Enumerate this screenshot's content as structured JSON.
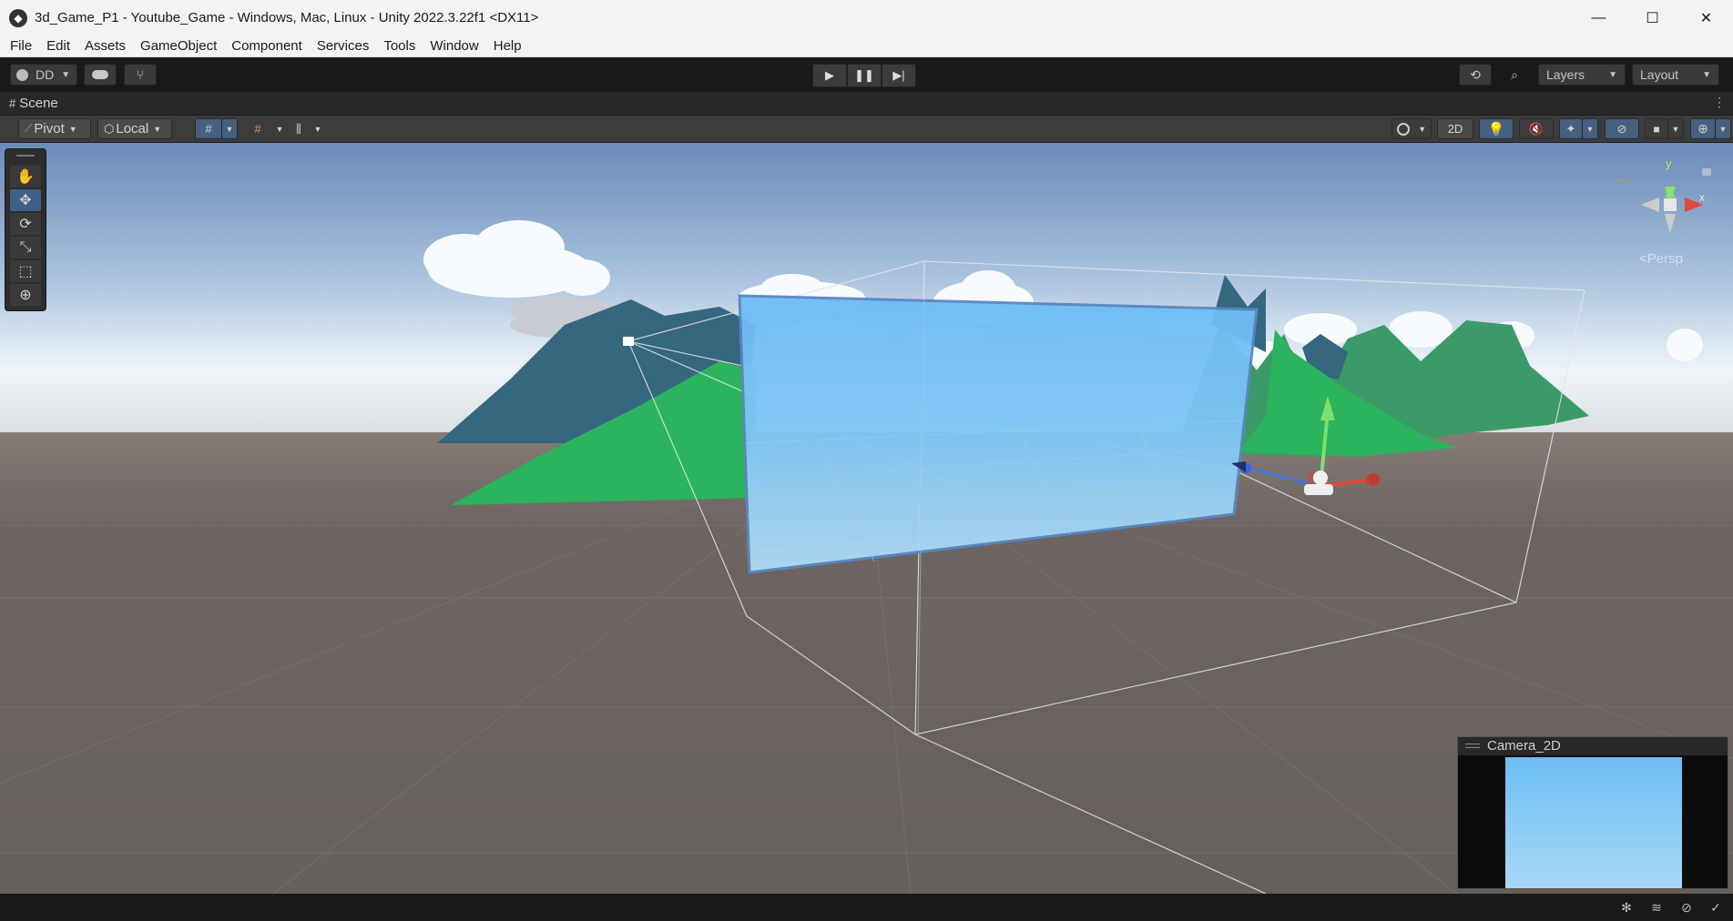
{
  "window": {
    "title": "3d_Game_P1 - Youtube_Game - Windows, Mac, Linux - Unity 2022.3.22f1 <DX11>",
    "minimize_glyph": "—",
    "maximize_glyph": "☐",
    "close_glyph": "✕"
  },
  "menu": {
    "items": [
      "File",
      "Edit",
      "Assets",
      "GameObject",
      "Component",
      "Services",
      "Tools",
      "Window",
      "Help"
    ]
  },
  "toolbar": {
    "account": "DD",
    "layers": "Layers",
    "layout": "Layout"
  },
  "scene_tab": {
    "label": "Scene"
  },
  "scene_toolbar": {
    "pivot": "Pivot",
    "local": "Local",
    "mode_2d": "2D"
  },
  "scene": {
    "projection": "Persp",
    "axis_y": "y",
    "axis_x": "x"
  },
  "camera_preview": {
    "title": "Camera_2D"
  },
  "colors": {
    "ground": "#6a625e",
    "sky_top": "#6b8cbc",
    "sky_horizon": "#eaf2f7",
    "dark_mountain": "#35677f",
    "green_mountain": "#2bb35d",
    "far_mountain": "#3c9a68",
    "panel_blue": "#6fbef7",
    "selection_blue": "#3f5f85"
  }
}
